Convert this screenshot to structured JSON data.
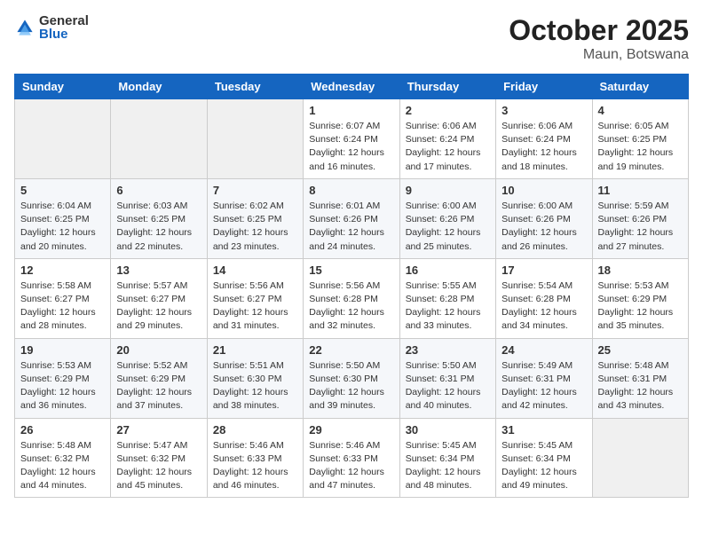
{
  "header": {
    "logo_general": "General",
    "logo_blue": "Blue",
    "month": "October 2025",
    "location": "Maun, Botswana"
  },
  "weekdays": [
    "Sunday",
    "Monday",
    "Tuesday",
    "Wednesday",
    "Thursday",
    "Friday",
    "Saturday"
  ],
  "weeks": [
    [
      {
        "day": "",
        "info": ""
      },
      {
        "day": "",
        "info": ""
      },
      {
        "day": "",
        "info": ""
      },
      {
        "day": "1",
        "info": "Sunrise: 6:07 AM\nSunset: 6:24 PM\nDaylight: 12 hours\nand 16 minutes."
      },
      {
        "day": "2",
        "info": "Sunrise: 6:06 AM\nSunset: 6:24 PM\nDaylight: 12 hours\nand 17 minutes."
      },
      {
        "day": "3",
        "info": "Sunrise: 6:06 AM\nSunset: 6:24 PM\nDaylight: 12 hours\nand 18 minutes."
      },
      {
        "day": "4",
        "info": "Sunrise: 6:05 AM\nSunset: 6:25 PM\nDaylight: 12 hours\nand 19 minutes."
      }
    ],
    [
      {
        "day": "5",
        "info": "Sunrise: 6:04 AM\nSunset: 6:25 PM\nDaylight: 12 hours\nand 20 minutes."
      },
      {
        "day": "6",
        "info": "Sunrise: 6:03 AM\nSunset: 6:25 PM\nDaylight: 12 hours\nand 22 minutes."
      },
      {
        "day": "7",
        "info": "Sunrise: 6:02 AM\nSunset: 6:25 PM\nDaylight: 12 hours\nand 23 minutes."
      },
      {
        "day": "8",
        "info": "Sunrise: 6:01 AM\nSunset: 6:26 PM\nDaylight: 12 hours\nand 24 minutes."
      },
      {
        "day": "9",
        "info": "Sunrise: 6:00 AM\nSunset: 6:26 PM\nDaylight: 12 hours\nand 25 minutes."
      },
      {
        "day": "10",
        "info": "Sunrise: 6:00 AM\nSunset: 6:26 PM\nDaylight: 12 hours\nand 26 minutes."
      },
      {
        "day": "11",
        "info": "Sunrise: 5:59 AM\nSunset: 6:26 PM\nDaylight: 12 hours\nand 27 minutes."
      }
    ],
    [
      {
        "day": "12",
        "info": "Sunrise: 5:58 AM\nSunset: 6:27 PM\nDaylight: 12 hours\nand 28 minutes."
      },
      {
        "day": "13",
        "info": "Sunrise: 5:57 AM\nSunset: 6:27 PM\nDaylight: 12 hours\nand 29 minutes."
      },
      {
        "day": "14",
        "info": "Sunrise: 5:56 AM\nSunset: 6:27 PM\nDaylight: 12 hours\nand 31 minutes."
      },
      {
        "day": "15",
        "info": "Sunrise: 5:56 AM\nSunset: 6:28 PM\nDaylight: 12 hours\nand 32 minutes."
      },
      {
        "day": "16",
        "info": "Sunrise: 5:55 AM\nSunset: 6:28 PM\nDaylight: 12 hours\nand 33 minutes."
      },
      {
        "day": "17",
        "info": "Sunrise: 5:54 AM\nSunset: 6:28 PM\nDaylight: 12 hours\nand 34 minutes."
      },
      {
        "day": "18",
        "info": "Sunrise: 5:53 AM\nSunset: 6:29 PM\nDaylight: 12 hours\nand 35 minutes."
      }
    ],
    [
      {
        "day": "19",
        "info": "Sunrise: 5:53 AM\nSunset: 6:29 PM\nDaylight: 12 hours\nand 36 minutes."
      },
      {
        "day": "20",
        "info": "Sunrise: 5:52 AM\nSunset: 6:29 PM\nDaylight: 12 hours\nand 37 minutes."
      },
      {
        "day": "21",
        "info": "Sunrise: 5:51 AM\nSunset: 6:30 PM\nDaylight: 12 hours\nand 38 minutes."
      },
      {
        "day": "22",
        "info": "Sunrise: 5:50 AM\nSunset: 6:30 PM\nDaylight: 12 hours\nand 39 minutes."
      },
      {
        "day": "23",
        "info": "Sunrise: 5:50 AM\nSunset: 6:31 PM\nDaylight: 12 hours\nand 40 minutes."
      },
      {
        "day": "24",
        "info": "Sunrise: 5:49 AM\nSunset: 6:31 PM\nDaylight: 12 hours\nand 42 minutes."
      },
      {
        "day": "25",
        "info": "Sunrise: 5:48 AM\nSunset: 6:31 PM\nDaylight: 12 hours\nand 43 minutes."
      }
    ],
    [
      {
        "day": "26",
        "info": "Sunrise: 5:48 AM\nSunset: 6:32 PM\nDaylight: 12 hours\nand 44 minutes."
      },
      {
        "day": "27",
        "info": "Sunrise: 5:47 AM\nSunset: 6:32 PM\nDaylight: 12 hours\nand 45 minutes."
      },
      {
        "day": "28",
        "info": "Sunrise: 5:46 AM\nSunset: 6:33 PM\nDaylight: 12 hours\nand 46 minutes."
      },
      {
        "day": "29",
        "info": "Sunrise: 5:46 AM\nSunset: 6:33 PM\nDaylight: 12 hours\nand 47 minutes."
      },
      {
        "day": "30",
        "info": "Sunrise: 5:45 AM\nSunset: 6:34 PM\nDaylight: 12 hours\nand 48 minutes."
      },
      {
        "day": "31",
        "info": "Sunrise: 5:45 AM\nSunset: 6:34 PM\nDaylight: 12 hours\nand 49 minutes."
      },
      {
        "day": "",
        "info": ""
      }
    ]
  ]
}
